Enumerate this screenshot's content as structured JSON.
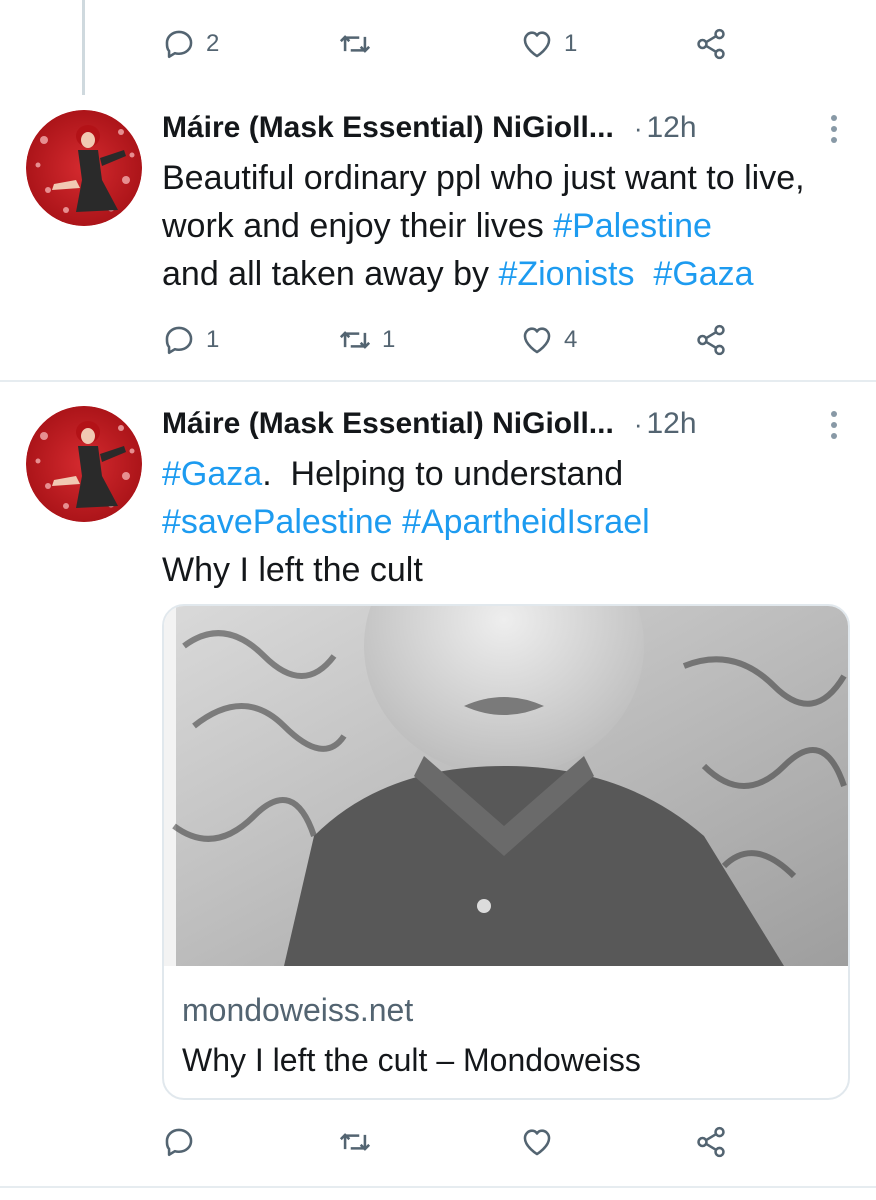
{
  "top_tweet_actions": {
    "reply_count": "2",
    "retweet_count": "",
    "like_count": "1"
  },
  "tweets": [
    {
      "author": "Máire (Mask Essential) NiGioll...",
      "separator": "·",
      "time": "12h",
      "text_parts": [
        "Beautiful ordinary ppl who just want to live, work and enjoy their lives ",
        "#Palestine",
        " and all taken away by ",
        "#Zionists",
        "  ",
        "#Gaza"
      ],
      "reply_count": "1",
      "retweet_count": "1",
      "like_count": "4"
    },
    {
      "author": "Máire (Mask Essential) NiGioll...",
      "separator": "·",
      "time": "12h",
      "text_parts": [
        "#Gaza",
        ".  Helping to understand",
        "#savePalestine",
        " ",
        "#ApartheidIsrael",
        "Why I left the cult"
      ],
      "card": {
        "domain": "mondoweiss.net",
        "title": "Why I left the cult – Mondoweiss"
      },
      "reply_count": "",
      "retweet_count": "",
      "like_count": ""
    }
  ],
  "icons": {
    "reply": "reply-icon",
    "retweet": "retweet-icon",
    "like": "heart-icon",
    "share": "share-icon",
    "more": "more-vertical-icon"
  },
  "colors": {
    "hashtag": "#1d9bf0",
    "secondary_text": "#536471",
    "divider": "#e6ecf0"
  }
}
